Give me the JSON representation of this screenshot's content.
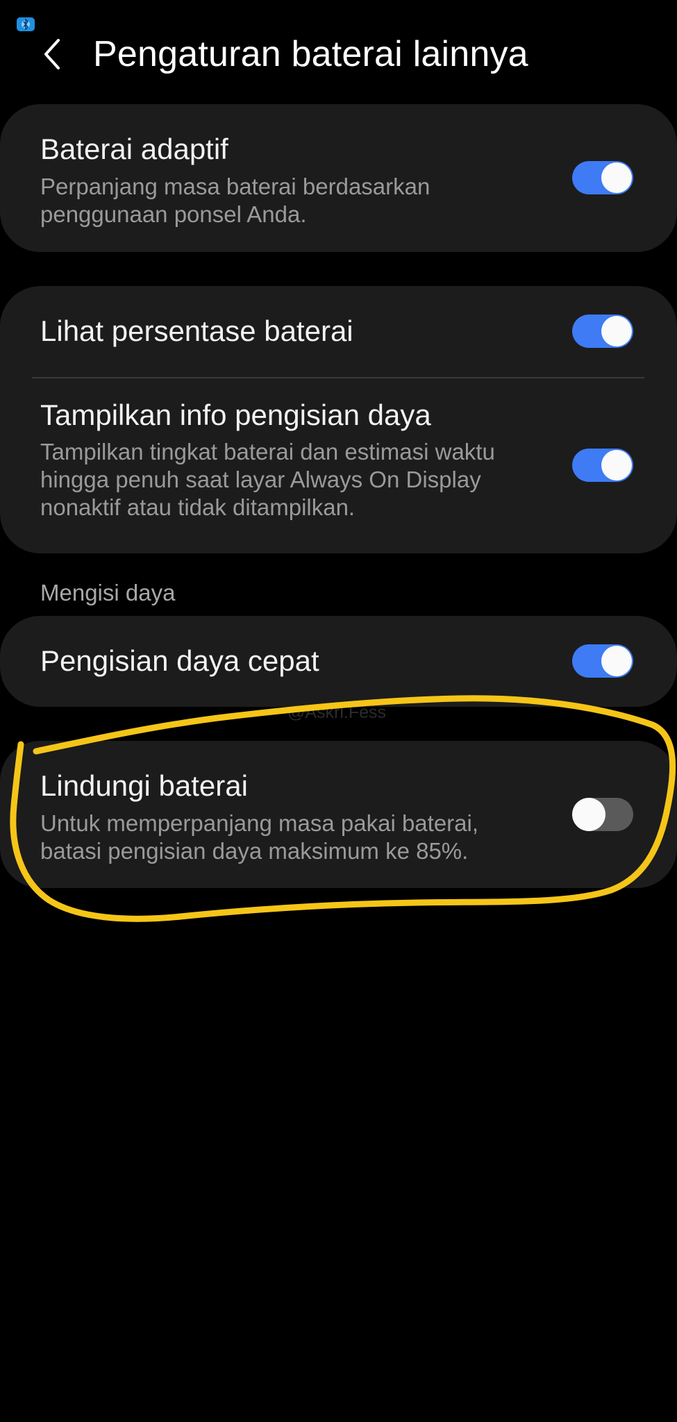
{
  "status_bar": {
    "icon": "bluetooth-app-icon"
  },
  "header": {
    "title": "Pengaturan baterai lainnya",
    "back_icon": "chevron-left-icon"
  },
  "groups": [
    {
      "items": [
        {
          "title": "Baterai adaptif",
          "description": "Perpanjang masa baterai berdasarkan penggunaan ponsel Anda.",
          "enabled": true
        }
      ]
    },
    {
      "items": [
        {
          "title": "Lihat persentase baterai",
          "enabled": true
        },
        {
          "title": "Tampilkan info pengisian daya",
          "description": "Tampilkan tingkat baterai dan estimasi waktu hingga penuh saat layar Always On Display nonaktif atau tidak ditampilkan.",
          "enabled": true
        }
      ]
    }
  ],
  "section_charging": {
    "header": "Mengisi daya",
    "items": [
      {
        "title": "Pengisian daya cepat",
        "enabled": true
      },
      {
        "title": "Lindungi baterai",
        "description": "Untuk memperpanjang masa pakai baterai, batasi pengisian daya maksimum ke 85%.",
        "enabled": false
      }
    ]
  },
  "watermark": "@Askrl.Fess",
  "colors": {
    "toggle_on": "#3e7bf5",
    "toggle_off": "#5a5a5a",
    "card_bg": "#1c1c1c",
    "highlight_stroke": "#f5c518"
  }
}
